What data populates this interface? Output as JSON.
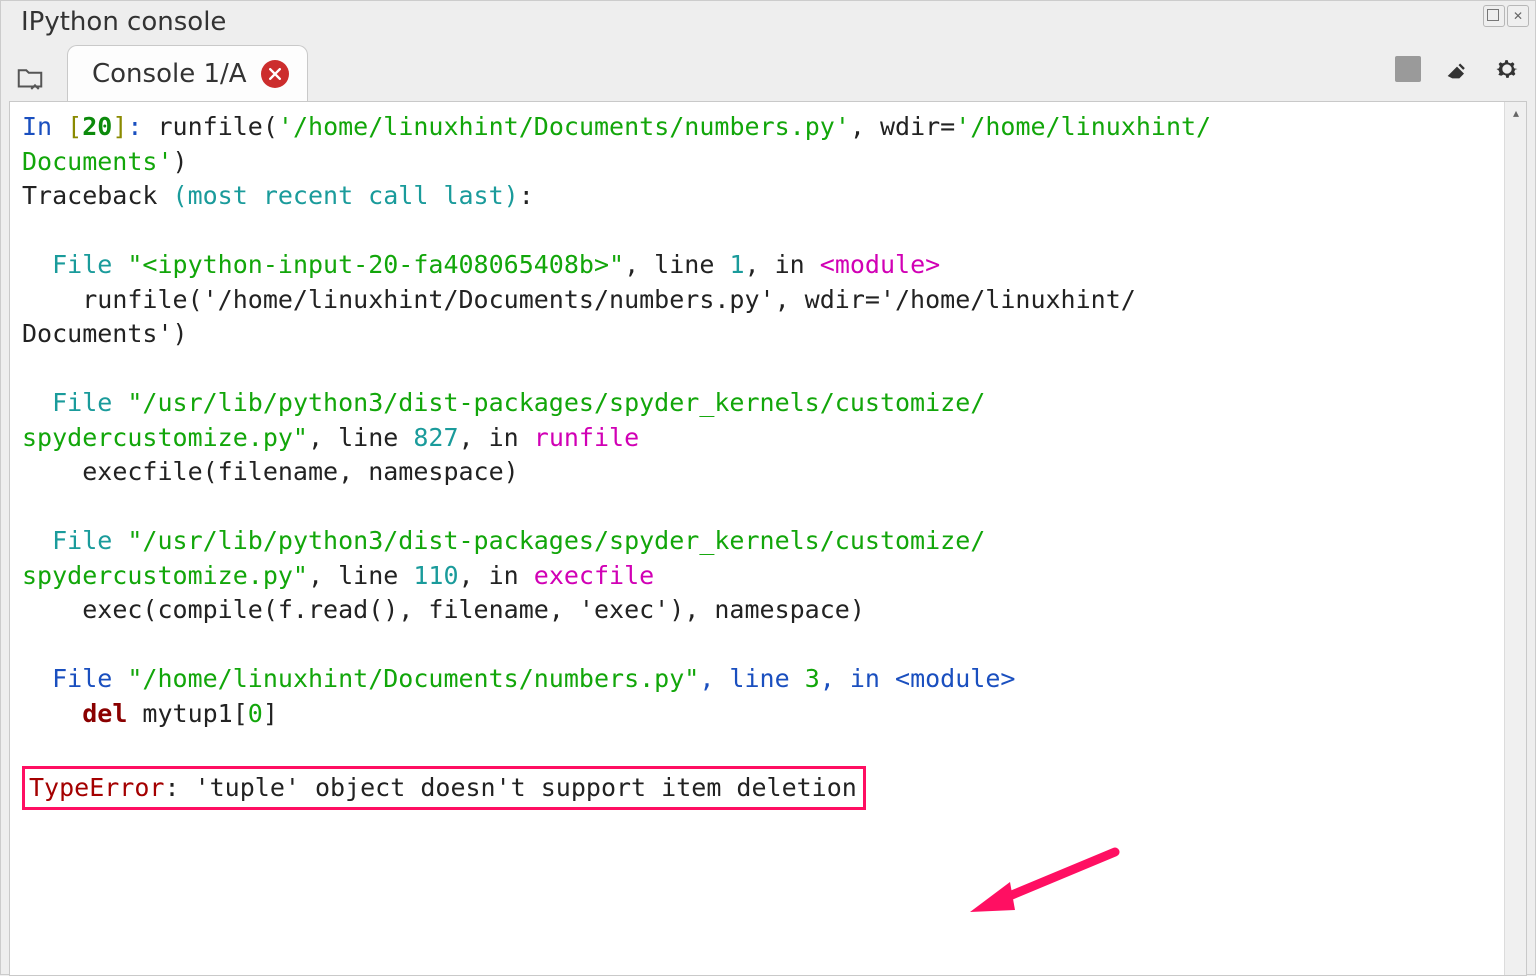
{
  "panel_title": "IPython console",
  "tab_label": "Console 1/A",
  "toolbar": {
    "stop_tooltip": "Stop",
    "clear_tooltip": "Clear",
    "options_tooltip": "Options"
  },
  "prompt": {
    "in_label": "In ",
    "num": "20",
    "colon": ": "
  },
  "run": {
    "head": "runfile(",
    "path": "'/home/linuxhint/Documents/numbers.py'",
    "wdir_key": ", wdir=",
    "wdir_val_a": "'/home/linuxhint/",
    "wdir_val_b": "Documents'",
    "tail": ")"
  },
  "traceback": {
    "label": "Traceback ",
    "note": "(most recent call last)",
    "colon": ":"
  },
  "frame1": {
    "file_kw": "File ",
    "path": "\"<ipython-input-20-fa408065408b>\"",
    "linekw": ", line ",
    "lineno": "1",
    "inkw": ", in ",
    "module": "<module>",
    "call_a": "    runfile('/home/linuxhint/Documents/numbers.py', wdir='/home/linuxhint/",
    "call_b": "Documents')"
  },
  "frame2": {
    "file_kw": "File ",
    "path_a": "\"/usr/lib/python3/dist-packages/spyder_kernels/customize/",
    "path_b": "spydercustomize.py\"",
    "linekw": ", line ",
    "lineno": "827",
    "inkw": ", in ",
    "func": "runfile",
    "call": "    execfile(filename, namespace)"
  },
  "frame3": {
    "file_kw": "File ",
    "path_a": "\"/usr/lib/python3/dist-packages/spyder_kernels/customize/",
    "path_b": "spydercustomize.py\"",
    "linekw": ", line ",
    "lineno": "110",
    "inkw": ", in ",
    "func": "execfile",
    "call": "    exec(compile(f.read(), filename, 'exec'), namespace)"
  },
  "frame4": {
    "file_kw": "File ",
    "path": "\"/home/linuxhint/Documents/numbers.py\"",
    "linekw": ", line ",
    "lineno": "3",
    "inkw": ", in ",
    "module": "<module>",
    "call_indent": "    ",
    "call_del": "del",
    "call_rest": " mytup1[",
    "call_idx": "0",
    "call_end": "]"
  },
  "error": {
    "type": "TypeError",
    "msg": ": 'tuple' object doesn't support item deletion"
  }
}
